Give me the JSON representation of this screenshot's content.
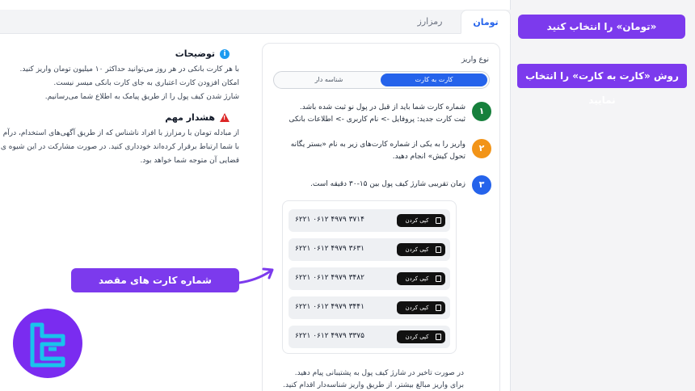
{
  "tabs": {
    "active": "تومان",
    "other": "رمزارز"
  },
  "info": {
    "desc_title": "توضیحات",
    "desc_lines": [
      "با هر کارت بانکی در هر روز می‌توانید حداکثر ۱۰ میلیون تومان واریز کنید.",
      "امکان افزودن کارت اعتباری به جای کارت بانکی میسر نیست.",
      "شارژ شدن کیف پول را از طریق پیامک به اطلاع شما می‌رسانیم."
    ],
    "warn_title": "هشدار مهم",
    "warn_lines": [
      "از مبادله تومان با رمزارز با افراد ناشناس که از طریق آگهی‌های استخدام، درآم",
      "با شما ارتباط برقرار کرده‌اند خودداری کنید. در صورت مشارکت در این شیوه ی",
      "قضایی آن متوجه شما خواهد بود."
    ]
  },
  "deposit": {
    "type_label": "نوع واریز",
    "options": {
      "selected": "کارت به کارت",
      "other": "شناسه دار"
    },
    "steps": [
      {
        "num": "۱",
        "color": "#16803c",
        "lines": [
          "شماره کارت شما باید از قبل در پول نو ثبت شده باشد.",
          "ثبت کارت جدید: پروفایل -> نام کاربری -> اطلاعات بانکی"
        ]
      },
      {
        "num": "۲",
        "color": "#f29418",
        "lines": [
          "واریز را به یکی از شماره کارت‌های زیر به نام «بستر یگانه",
          "تحول کیش» انجام دهید."
        ]
      },
      {
        "num": "۳",
        "color": "#2563eb",
        "lines": [
          "زمان تقریبی شارژ کیف پول بین ۱۵-۳۰ دقیقه است."
        ]
      }
    ],
    "copy_label": "کپی کردن",
    "cards": [
      "۶۲۲۱ ۰۶۱۲ ۴۹۷۹ ۳۷۱۴",
      "۶۲۲۱ ۰۶۱۲ ۴۹۷۹ ۳۶۳۱",
      "۶۲۲۱ ۰۶۱۲ ۴۹۷۹ ۳۴۸۲",
      "۶۲۲۱ ۰۶۱۲ ۴۹۷۹ ۳۴۴۱",
      "۶۲۲۱ ۰۶۱۲ ۴۹۷۹ ۳۳۷۵"
    ],
    "footer_lines": [
      "در صورت تاخیر در شارژ کیف پول به پشتیبانی پیام دهید.",
      "برای واریز مبالغ بیشتر، از طریق واریز شناسه‌دار اقدام کنید."
    ]
  },
  "annotations": {
    "select_toman": "«تومان» را انتخاب کنید",
    "select_method": "روش «کارت به کارت» را انتخاب نمایید",
    "dest_cards": "شماره کارت های مقصد"
  },
  "colors": {
    "accent": "#2563eb",
    "annotation": "#7c3aed",
    "warning": "#dc2626",
    "info": "#1d9bf0"
  },
  "icons": [
    "info-icon",
    "warning-icon",
    "copy-icon",
    "arrow-icon",
    "brand-logo"
  ]
}
